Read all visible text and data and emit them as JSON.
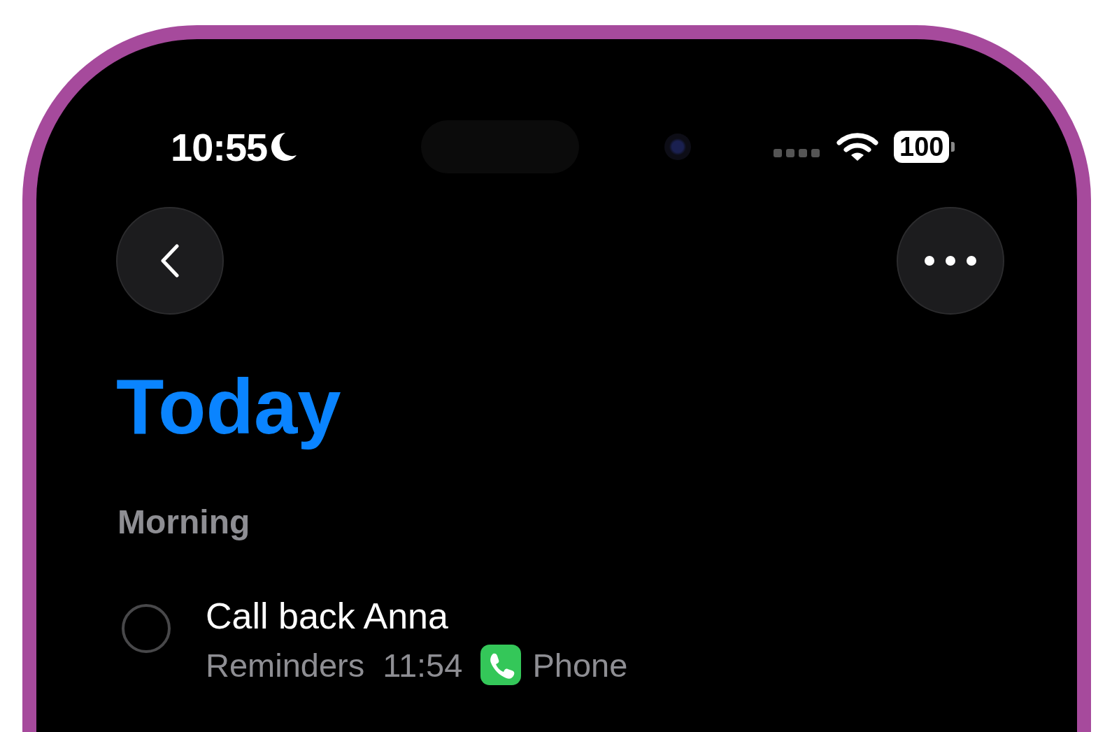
{
  "status_bar": {
    "time": "10:55",
    "battery": "100"
  },
  "title": "Today",
  "sections": [
    {
      "heading": "Morning",
      "items": [
        {
          "title": "Call back Anna",
          "checked": false,
          "list": "Reminders",
          "time": "11:54",
          "app": "Phone"
        }
      ]
    }
  ]
}
